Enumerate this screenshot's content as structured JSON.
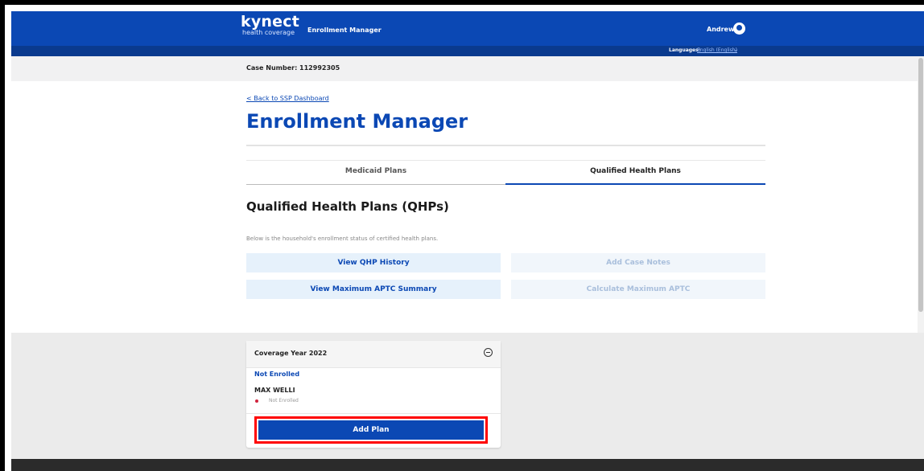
{
  "header": {
    "logo_text": "kynect",
    "logo_subtext": "health coverage",
    "app_name": "Enrollment Manager",
    "user_name": "Andrew"
  },
  "language": {
    "label": "Languages:",
    "value": "English (English)"
  },
  "case": {
    "number_label": "Case Number: 112992305"
  },
  "page": {
    "back_link": "< Back to SSP Dashboard",
    "title": "Enrollment Manager"
  },
  "tabs": [
    {
      "label": "Medicaid Plans",
      "active": false
    },
    {
      "label": "Qualified Health Plans",
      "active": true
    }
  ],
  "section": {
    "title": "Qualified Health Plans (QHPs)",
    "description": "Below is the household's enrollment status of certified health plans."
  },
  "actions": [
    {
      "label": "View QHP History",
      "enabled": true
    },
    {
      "label": "Add Case Notes",
      "enabled": false
    },
    {
      "label": "View Maximum APTC Summary",
      "enabled": true
    },
    {
      "label": "Calculate Maximum APTC",
      "enabled": false
    }
  ],
  "coverage_card": {
    "title": "Coverage Year 2022",
    "status": "Not Enrolled",
    "member_name": "MAX WELLI",
    "member_status": "Not Enrolled",
    "add_button_label": "Add Plan"
  },
  "colors": {
    "brand_blue": "#0b48b4",
    "highlight_red": "#ff0000",
    "status_dot": "#d0243e"
  }
}
